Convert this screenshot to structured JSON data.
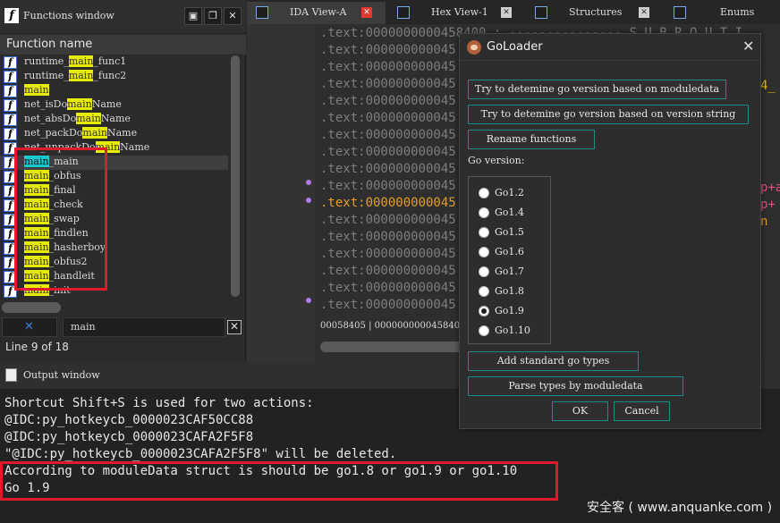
{
  "functions_window": {
    "title": "Functions window",
    "column_header": "Function name",
    "functions": [
      {
        "pre": "runtime_",
        "hl": "main",
        "post": "_func1",
        "style": "hl"
      },
      {
        "pre": "runtime_",
        "hl": "main",
        "post": "_func2",
        "style": "hl"
      },
      {
        "pre": "",
        "hl": "main",
        "post": "",
        "style": "hl"
      },
      {
        "pre": "net_isDo",
        "hl": "main",
        "post": "Name",
        "style": "hl"
      },
      {
        "pre": "net_absDo",
        "hl": "main",
        "post": "Name",
        "style": "hl"
      },
      {
        "pre": "net_packDo",
        "hl": "main",
        "post": "Name",
        "style": "hl"
      },
      {
        "pre": "net_unpackDo",
        "hl": "main",
        "post": "Name",
        "style": "hl"
      },
      {
        "pre": "",
        "hl": "main",
        "post": "_main",
        "style": "hlc",
        "selected": true
      },
      {
        "pre": "",
        "hl": "main",
        "post": "_obfus",
        "style": "hl"
      },
      {
        "pre": "",
        "hl": "main",
        "post": "_final",
        "style": "hl"
      },
      {
        "pre": "",
        "hl": "main",
        "post": "_check",
        "style": "hl"
      },
      {
        "pre": "",
        "hl": "main",
        "post": "_swap",
        "style": "hl"
      },
      {
        "pre": "",
        "hl": "main",
        "post": "_findlen",
        "style": "hl"
      },
      {
        "pre": "",
        "hl": "main",
        "post": "_hasherboy",
        "style": "hl"
      },
      {
        "pre": "",
        "hl": "main",
        "post": "_obfus2",
        "style": "hl"
      },
      {
        "pre": "",
        "hl": "main",
        "post": "_handleit",
        "style": "hl"
      },
      {
        "pre": "",
        "hl": "main",
        "post": "_init",
        "style": "hl"
      }
    ],
    "search_value": "main",
    "status": "Line 9 of 18"
  },
  "tabs": [
    {
      "label": "IDA View-A",
      "active": true,
      "close": "red"
    },
    {
      "label": "Hex View-1",
      "close": "gray"
    },
    {
      "label": "Structures",
      "close": "gray"
    },
    {
      "label": "Enums"
    }
  ],
  "ida_view": {
    "lines": [
      ".text:0000000000458400 ; --------------- S U B R O U T I",
      ".text:000000000045",
      ".text:000000000045",
      ".text:000000000045",
      ".text:000000000045",
      ".text:000000000045",
      ".text:000000000045",
      ".text:000000000045",
      ".text:000000000045",
      ".text:000000000045",
      ".text:000000000045",
      ".text:000000000045",
      ".text:000000000045",
      ".text:000000000045",
      ".text:000000000045",
      ".text:000000000045",
      ".text:000000000045"
    ],
    "address_bar": "00058405 | 0000000000458405:"
  },
  "output_window": {
    "title": "Output window",
    "lines": [
      "Shortcut Shift+S is used for two actions:",
      "  @IDC:py_hotkeycb_0000023CAF50CC88",
      "  @IDC:py_hotkeycb_0000023CAFA2F5F8",
      "\"@IDC:py_hotkeycb_0000023CAFA2F5F8\" will be deleted.",
      "According to moduleData struct is should be go1.8 or go1.9 or go1.10",
      "Go 1.9"
    ],
    "watermark": "安全客 ( www.anquanke.com )"
  },
  "dialog": {
    "title": "GoLoader",
    "btn_moduledata": "Try to detemine go version based on moduledata",
    "btn_version_string": "Try to detemine go version based on version string",
    "btn_rename": "Rename functions",
    "go_version_label": "Go version:",
    "versions": [
      "Go1.2",
      "Go1.4",
      "Go1.5",
      "Go1.6",
      "Go1.7",
      "Go1.8",
      "Go1.9",
      "Go1.10"
    ],
    "selected_version": "Go1.9",
    "btn_add_types": "Add standard go types",
    "btn_parse_types": "Parse types by moduledata",
    "btn_ok": "OK",
    "btn_cancel": "Cancel"
  }
}
